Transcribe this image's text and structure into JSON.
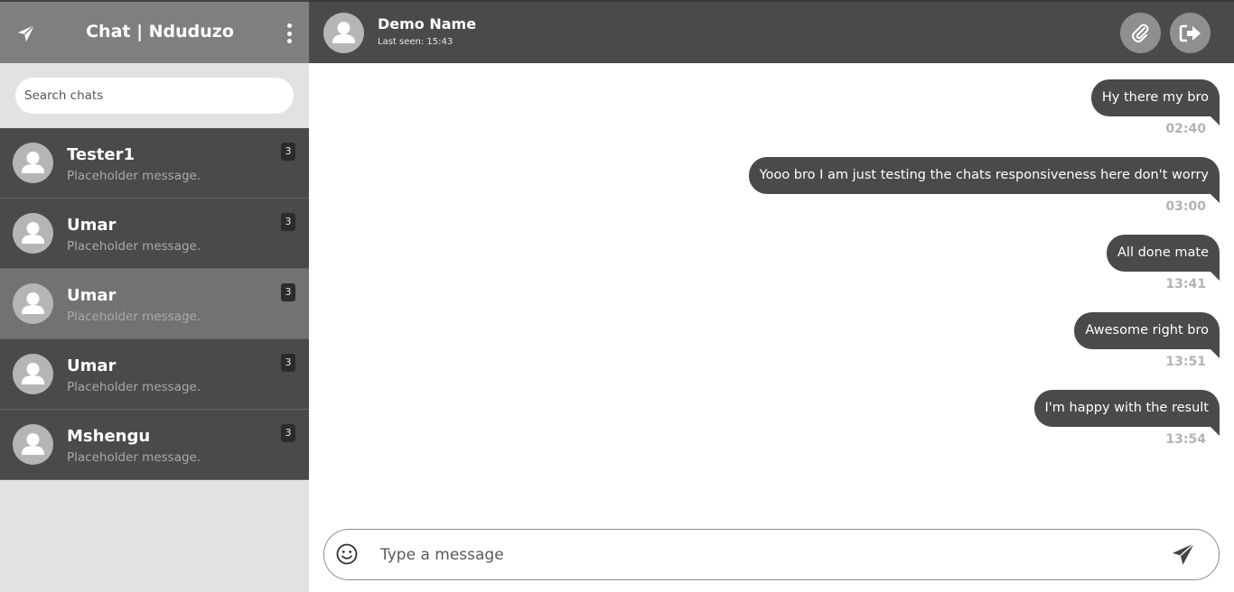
{
  "sidebar": {
    "title": "Chat | Nduduzo",
    "brand_icon": "paper-plane-icon",
    "menu_icon": "kebab-menu-icon",
    "search_placeholder": "Search chats",
    "chats": [
      {
        "name": "Tester1",
        "preview": "Placeholder message.",
        "badge": "3"
      },
      {
        "name": "Umar",
        "preview": "Placeholder message.",
        "badge": "3"
      },
      {
        "name": "Umar",
        "preview": "Placeholder message.",
        "badge": "3"
      },
      {
        "name": "Umar",
        "preview": "Placeholder message.",
        "badge": "3"
      },
      {
        "name": "Mshengu",
        "preview": "Placeholder message.",
        "badge": "3"
      }
    ]
  },
  "header": {
    "name": "Demo Name",
    "last_seen": "Last seen: 15:43",
    "attach_icon": "paperclip-icon",
    "logout_icon": "sign-out-icon"
  },
  "messages": [
    {
      "text": "Hy there my bro",
      "time": "02:40"
    },
    {
      "text": "Yooo bro I am just testing the chats responsiveness here don't worry",
      "time": "03:00"
    },
    {
      "text": "All done mate",
      "time": "13:41"
    },
    {
      "text": "Awesome right bro",
      "time": "13:51"
    },
    {
      "text": "I'm happy with the result",
      "time": "13:54"
    }
  ],
  "composer": {
    "placeholder": "Type a message",
    "emoji_icon": "smiley-icon",
    "send_icon": "paper-plane-icon"
  },
  "colors": {
    "sidebar_header": "#7f7f7f",
    "chat_item": "#4a4a4a",
    "chat_item_active": "#727272",
    "bubble": "#4a4a4a",
    "topbar": "#4a4a4a"
  }
}
